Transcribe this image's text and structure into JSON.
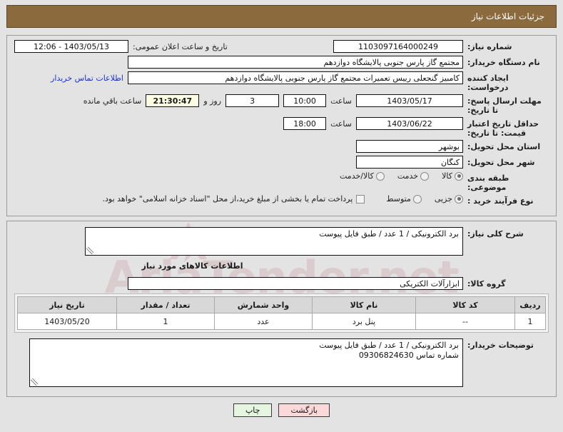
{
  "header": {
    "title": "جزئیات اطلاعات نیاز",
    "bar_color": "#8b6b3e"
  },
  "watermark": {
    "text": "AriaTender.net"
  },
  "top_section": {
    "need_number": {
      "label": "شماره نیاز:",
      "value": "1103097164000249"
    },
    "public_announce": {
      "label": "تاریخ و ساعت اعلان عمومی:",
      "value": "1403/05/13 - 12:06"
    },
    "buyer_org": {
      "label": "نام دستگاه خریدار:",
      "value": "مجتمع گاز پارس جنوبی  پالایشگاه دوازدهم"
    },
    "requester": {
      "label": "ایجاد کننده درخواست:",
      "value": "کامبیز گنجعلی رییس تعمیرات مجتمع گاز پارس جنوبی  پالایشگاه دوازدهم"
    },
    "buyer_contact_link": "اطلاعات تماس خریدار",
    "response_deadline": {
      "label": "مهلت ارسال پاسخ: تا تاریخ:",
      "date": "1403/05/17",
      "hour_label": "ساعت",
      "hour": "10:00",
      "days": "3",
      "days_suffix": "روز و",
      "countdown": "21:30:47",
      "countdown_suffix": "ساعت باقي مانده"
    },
    "price_validity": {
      "label": "حداقل تاریخ اعتبار قیمت: تا تاریخ:",
      "date": "1403/06/22",
      "hour_label": "ساعت",
      "hour": "18:00"
    },
    "delivery_province": {
      "label": "استان محل تحویل:",
      "value": "بوشهر"
    },
    "delivery_city": {
      "label": "شهر محل تحویل:",
      "value": "کنگان"
    },
    "subject_classification": {
      "label": "طبقه بندی موضوعی:",
      "options": [
        {
          "label": "کالا",
          "selected": true
        },
        {
          "label": "خدمت",
          "selected": false
        },
        {
          "label": "کالا/خدمت",
          "selected": false
        }
      ]
    },
    "purchase_process": {
      "label": "نوع فرآیند خرید :",
      "options": [
        {
          "label": "جزیی",
          "selected": true
        },
        {
          "label": "متوسط",
          "selected": false
        }
      ],
      "checkbox_label": "پرداخت تمام یا بخشی از مبلغ خرید،از محل \"اسناد خزانه اسلامی\" خواهد بود.",
      "checkbox_checked": false
    }
  },
  "middle_section": {
    "need_summary": {
      "label": "شرح کلی نیاز:",
      "value": "برد الکترونیکی / 1 عدد / طبق فایل پیوست"
    },
    "goods_section_title": "اطلاعات کالاهای مورد نیاز",
    "goods_group": {
      "label": "گروه کالا:",
      "value": "ابزارآلات الکتریکی"
    },
    "items_table": {
      "columns": [
        "ردیف",
        "کد کالا",
        "نام کالا",
        "واحد شمارش",
        "تعداد / مقدار",
        "تاریخ نیاز"
      ],
      "rows": [
        {
          "row": "1",
          "code": "--",
          "name": "پنل برد",
          "unit": "عدد",
          "qty": "1",
          "date": "1403/05/20"
        }
      ]
    },
    "buyer_notes": {
      "label": "توضیحات خریدار:",
      "value": "برد الکترونیکی / 1 عدد / طبق فایل پیوست\nشماره تماس 09306824630"
    }
  },
  "footer": {
    "print_label": "چاپ",
    "back_label": "بازگشت"
  }
}
